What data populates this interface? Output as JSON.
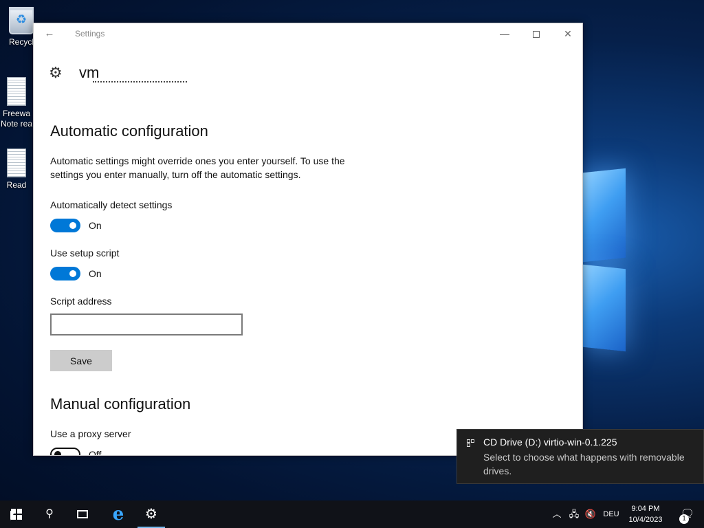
{
  "desktop": {
    "icons": [
      {
        "label": "Recycl",
        "icon": "recycle-bin-icon"
      },
      {
        "label": "Freewa\nNote rea",
        "icon": "document-icon"
      },
      {
        "label": "Read",
        "icon": "document-icon"
      }
    ]
  },
  "window": {
    "title": "Settings",
    "back_glyph": "←",
    "minimize_glyph": "—",
    "close_glyph": "✕",
    "page_title": "vm",
    "automatic": {
      "heading": "Automatic configuration",
      "description": "Automatic settings might override ones you enter yourself. To use the settings you enter manually, turn off the automatic settings.",
      "detect_label": "Automatically detect settings",
      "detect_state": "On",
      "script_label": "Use setup script",
      "script_state": "On",
      "address_label": "Script address",
      "address_value": "",
      "save_label": "Save"
    },
    "manual": {
      "heading": "Manual configuration",
      "proxy_label": "Use a proxy server",
      "proxy_state": "Off"
    }
  },
  "toast": {
    "title": "CD Drive (D:) virtio-win-0.1.225",
    "body": "Select to choose what happens with removable drives."
  },
  "taskbar": {
    "language": "DEU",
    "time": "9:04 PM",
    "date": "10/4/2023",
    "notification_count": "1",
    "accent_color": "#76b9ed"
  },
  "colors": {
    "toggle_on": "#0078d7",
    "button_gray": "#cccccc"
  }
}
